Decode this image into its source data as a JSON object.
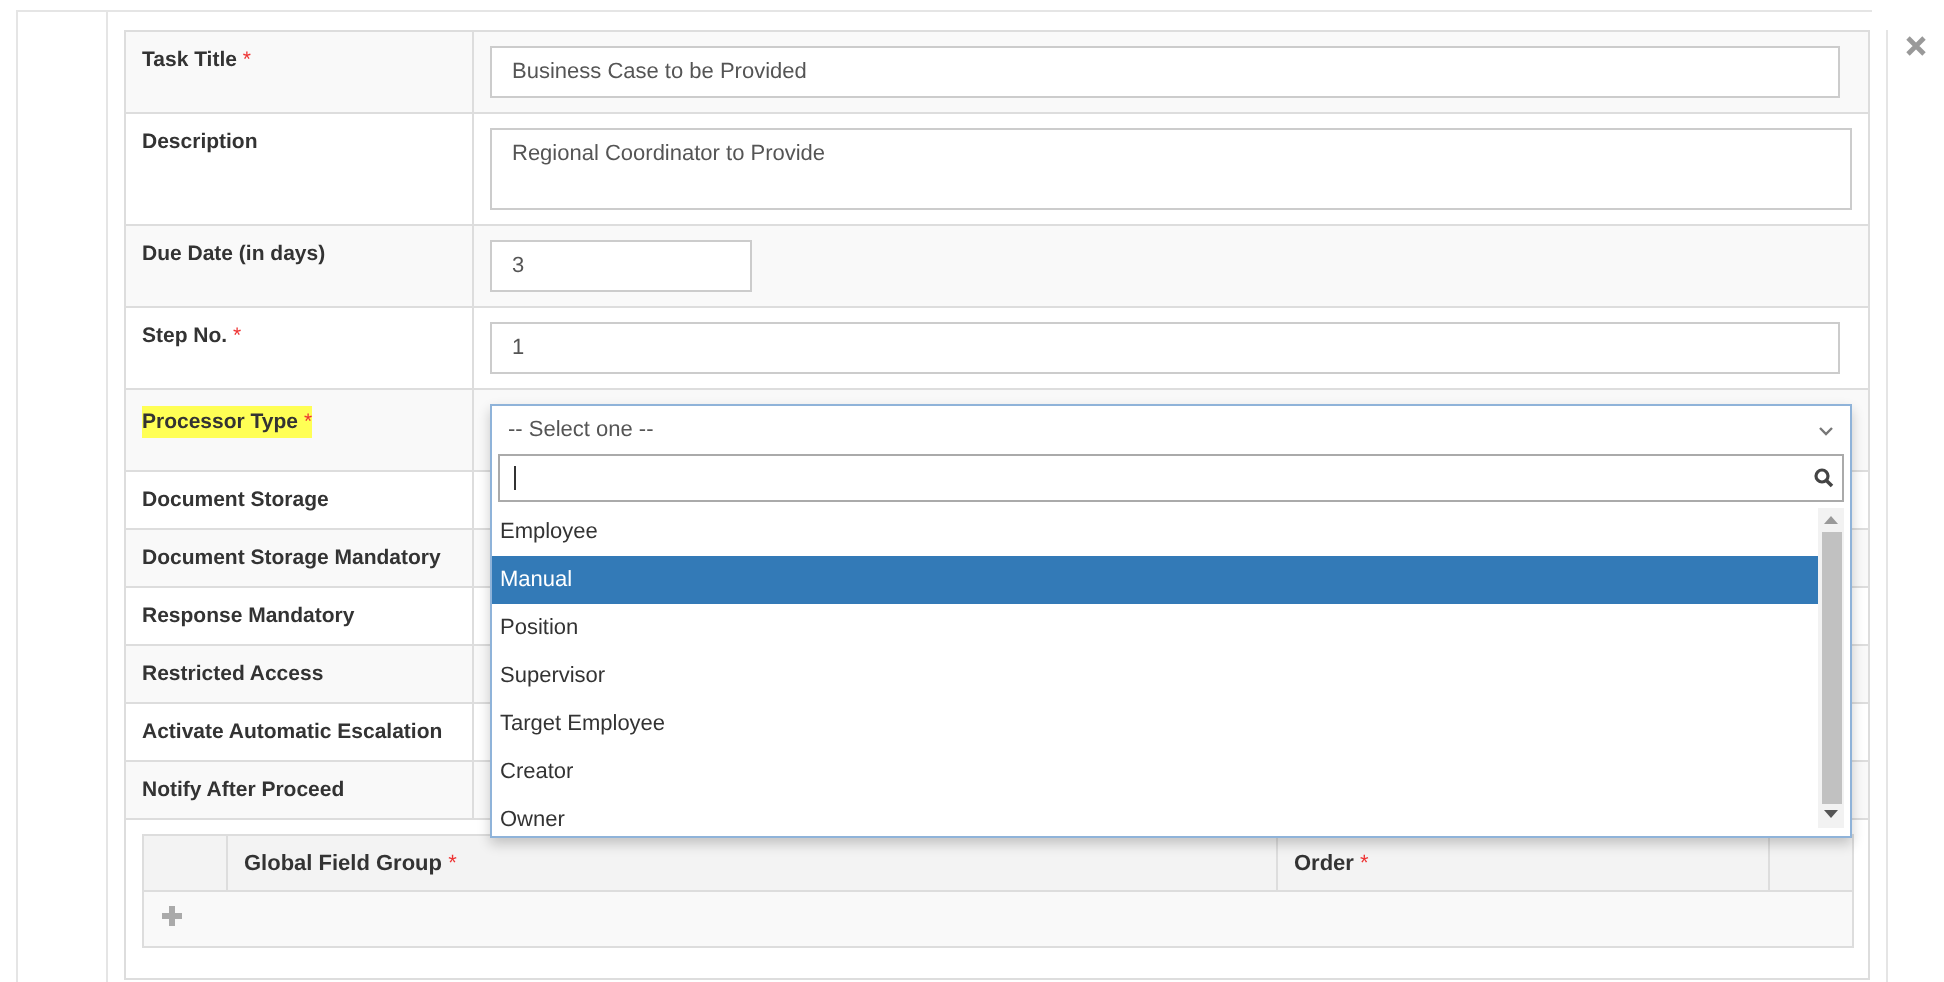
{
  "fields": [
    {
      "label": "Task Title",
      "required_mark": "*",
      "highlighted": false,
      "kind": "text",
      "value": "Business Case to be Provided"
    },
    {
      "label": "Description",
      "highlighted": false,
      "kind": "textarea",
      "value": "Regional Coordinator to Provide"
    },
    {
      "label": "Due Date (in days)",
      "highlighted": false,
      "kind": "number",
      "value": "3"
    },
    {
      "label": "Step No.",
      "required_mark": "*",
      "highlighted": false,
      "kind": "text",
      "value": "1"
    },
    {
      "label": "Processor Type",
      "required_mark": "*",
      "highlighted": true,
      "kind": "select"
    },
    {
      "label": "Document Storage",
      "highlighted": false
    },
    {
      "label": "Document Storage Mandatory",
      "highlighted": false
    },
    {
      "label": "Response Mandatory",
      "highlighted": false
    },
    {
      "label": "Restricted Access",
      "highlighted": false
    },
    {
      "label": "Activate Automatic Escalation",
      "highlighted": false
    },
    {
      "label": "Notify After Proceed",
      "highlighted": false
    }
  ],
  "dropdown": {
    "placeholder": "-- Select one --",
    "options": [
      {
        "label": "Employee",
        "selected": false
      },
      {
        "label": "Manual",
        "selected": true
      },
      {
        "label": "Position",
        "selected": false
      },
      {
        "label": "Supervisor",
        "selected": false
      },
      {
        "label": "Target Employee",
        "selected": false
      },
      {
        "label": "Creator",
        "selected": false
      },
      {
        "label": "Owner",
        "selected": false
      }
    ]
  },
  "field_groups": {
    "columns": [
      {
        "label": "Global Field Group",
        "required_mark": "*"
      },
      {
        "label": "Order",
        "required_mark": "*"
      }
    ]
  }
}
